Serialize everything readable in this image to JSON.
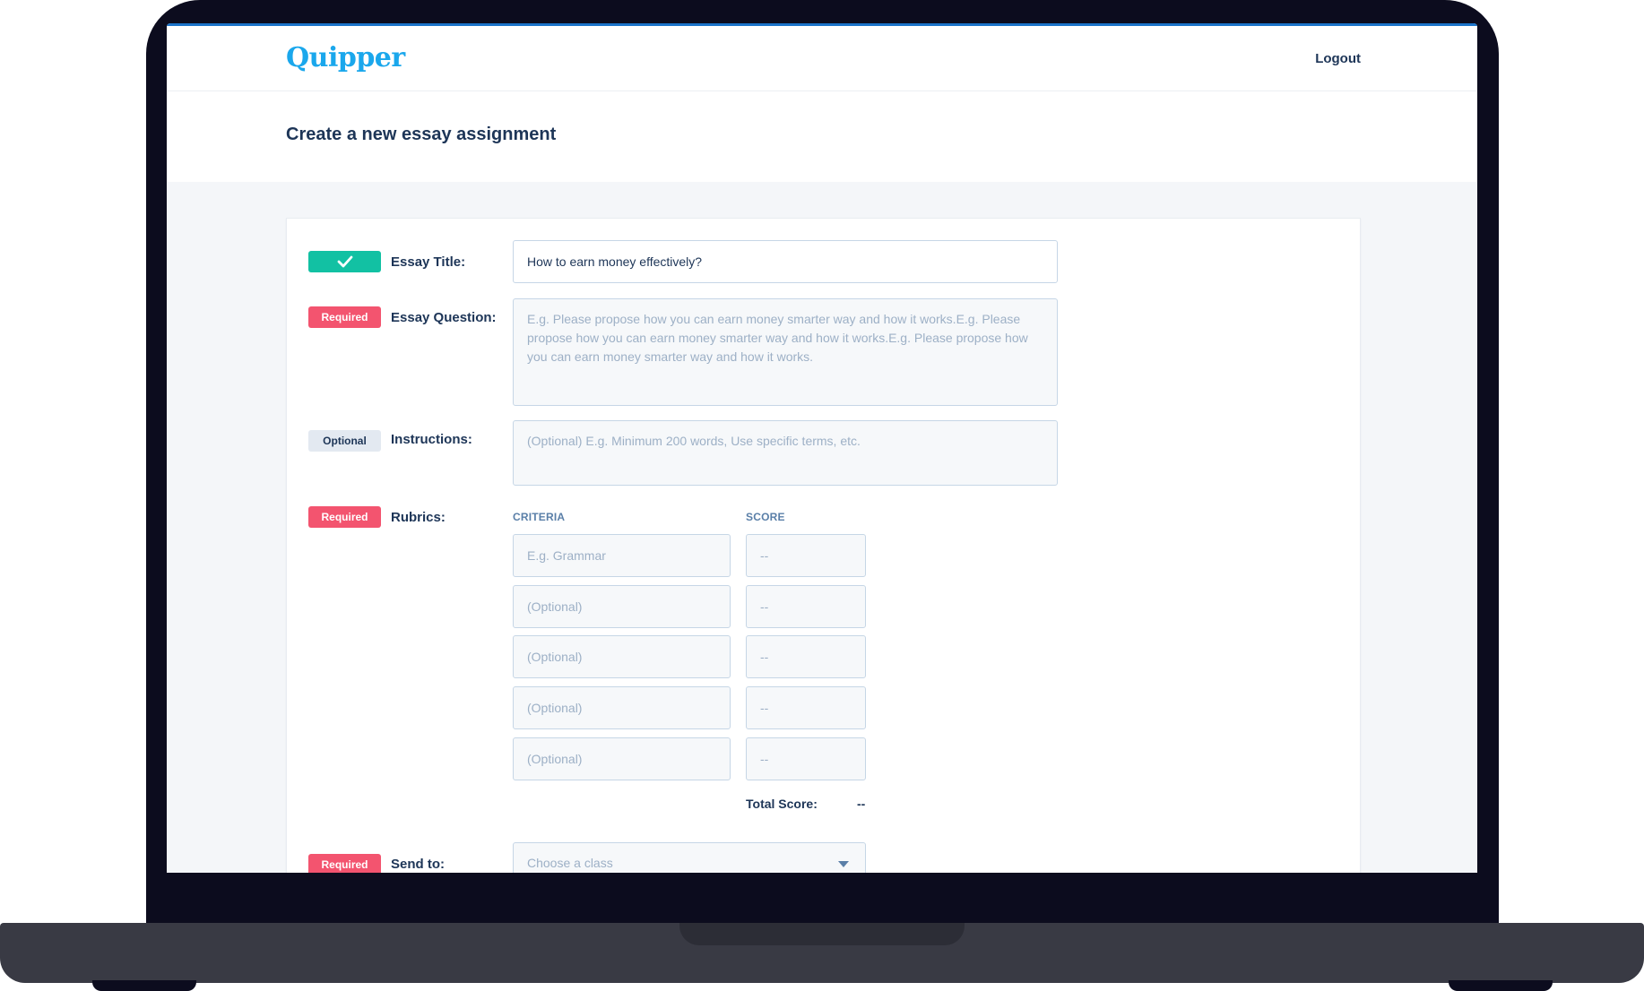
{
  "app": {
    "logo": "Quipper",
    "logout_label": "Logout",
    "page_title": "Create a new essay assignment"
  },
  "colors": {
    "brand": "#1aa7ec",
    "required_badge": "#f3546f",
    "done_badge": "#12c1a3",
    "optional_badge": "#e3e9f1",
    "text_dark": "#1d3557"
  },
  "form": {
    "essay_title": {
      "status_icon": "check-icon",
      "label": "Essay Title:",
      "value": "How to earn money effectively?"
    },
    "essay_question": {
      "badge": "Required",
      "label": "Essay Question:",
      "placeholder": "E.g. Please propose how you can earn money smarter way and how it works.E.g. Please propose how you can earn money smarter way and how it works.E.g. Please propose how you can earn money smarter way and how it works."
    },
    "instructions": {
      "badge": "Optional",
      "label": "Instructions:",
      "placeholder": "(Optional) E.g. Minimum 200 words, Use specific terms, etc."
    },
    "rubrics": {
      "badge": "Required",
      "label": "Rubrics:",
      "criteria_header": "CRITERIA",
      "score_header": "SCORE",
      "rows": [
        {
          "criteria_placeholder": "E.g. Grammar",
          "score_placeholder": "--"
        },
        {
          "criteria_placeholder": "(Optional)",
          "score_placeholder": "--"
        },
        {
          "criteria_placeholder": "(Optional)",
          "score_placeholder": "--"
        },
        {
          "criteria_placeholder": "(Optional)",
          "score_placeholder": "--"
        },
        {
          "criteria_placeholder": "(Optional)",
          "score_placeholder": "--"
        }
      ],
      "total_label": "Total Score:",
      "total_value": "--"
    },
    "send_to": {
      "badge": "Required",
      "label": "Send to:",
      "placeholder": "Choose a class",
      "icon": "chevron-down-icon"
    }
  }
}
